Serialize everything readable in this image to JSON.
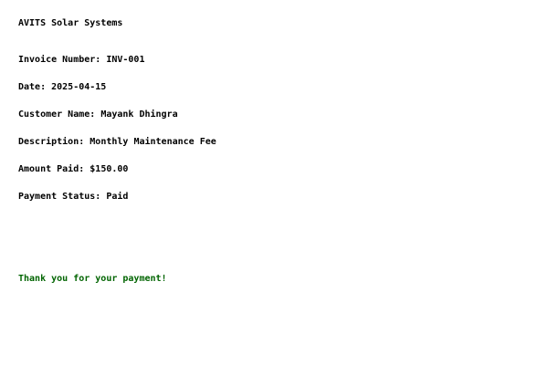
{
  "company": "AVITS Solar Systems",
  "fields": {
    "invoice_number": {
      "label": "Invoice Number:",
      "value": "INV-001"
    },
    "date": {
      "label": "Date:",
      "value": "2025-04-15"
    },
    "customer_name": {
      "label": "Customer Name:",
      "value": "Mayank Dhingra"
    },
    "description": {
      "label": "Description:",
      "value": "Monthly Maintenance Fee"
    },
    "amount_paid": {
      "label": "Amount Paid:",
      "value": "$150.00"
    },
    "payment_status": {
      "label": "Payment Status:",
      "value": "Paid"
    }
  },
  "thank_you": "Thank you for your payment!",
  "colors": {
    "text": "#000000",
    "thank_you": "#006400",
    "background": "#ffffff"
  }
}
